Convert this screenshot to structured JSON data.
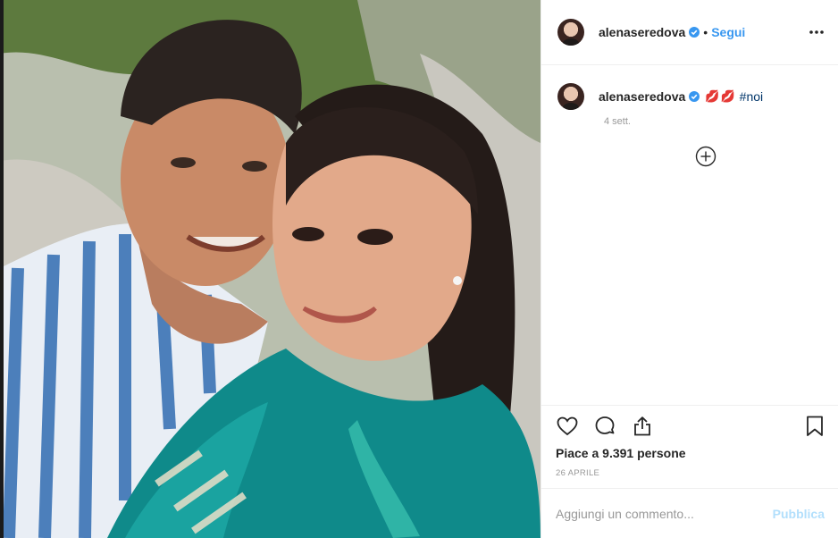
{
  "photo": {
    "alt": ""
  },
  "header": {
    "username": "alenaseredova",
    "separator": "•",
    "follow_label": "Segui"
  },
  "caption": {
    "username": "alenaseredova",
    "emoji": "💋💋",
    "hashtag": "#noi",
    "time_ago": "4 sett."
  },
  "actions": {
    "likes_text": "Piace a 9.391 persone",
    "date": "26 APRILE"
  },
  "comment": {
    "placeholder": "Aggiungi un commento...",
    "publish_label": "Pubblica"
  },
  "colors": {
    "accent": "#3897f0",
    "hashtag": "#003569",
    "muted": "#999999",
    "publish_disabled": "#b2dffc",
    "text": "#262626"
  },
  "icons": [
    "verified-badge-icon",
    "more-options-icon",
    "add-reply-icon",
    "heart-icon",
    "comment-icon",
    "share-icon",
    "bookmark-icon"
  ]
}
